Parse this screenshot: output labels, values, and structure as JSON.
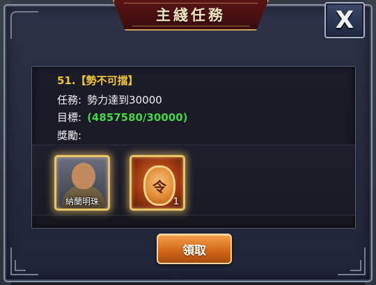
{
  "dialog": {
    "title": "主綫任務",
    "close_label": "X"
  },
  "quest": {
    "name": "51.【勢不可擋】",
    "task_label": "任務:",
    "task_value": "勢力達到30000",
    "goal_label": "目標:",
    "goal_value": "(4857580/30000)",
    "reward_label": "獎勵:"
  },
  "rewards": [
    {
      "type": "hero",
      "name": "納蘭明珠",
      "icon": "hero-portrait-icon"
    },
    {
      "type": "item",
      "glyph": "令",
      "count": "1",
      "icon": "command-token-icon"
    }
  ],
  "actions": {
    "claim_label": "領取"
  },
  "colors": {
    "quest_name": "#f0c43a",
    "goal_value": "#47d64a",
    "title_plate": "#5a1515",
    "claim_button": "#d46a1a"
  }
}
